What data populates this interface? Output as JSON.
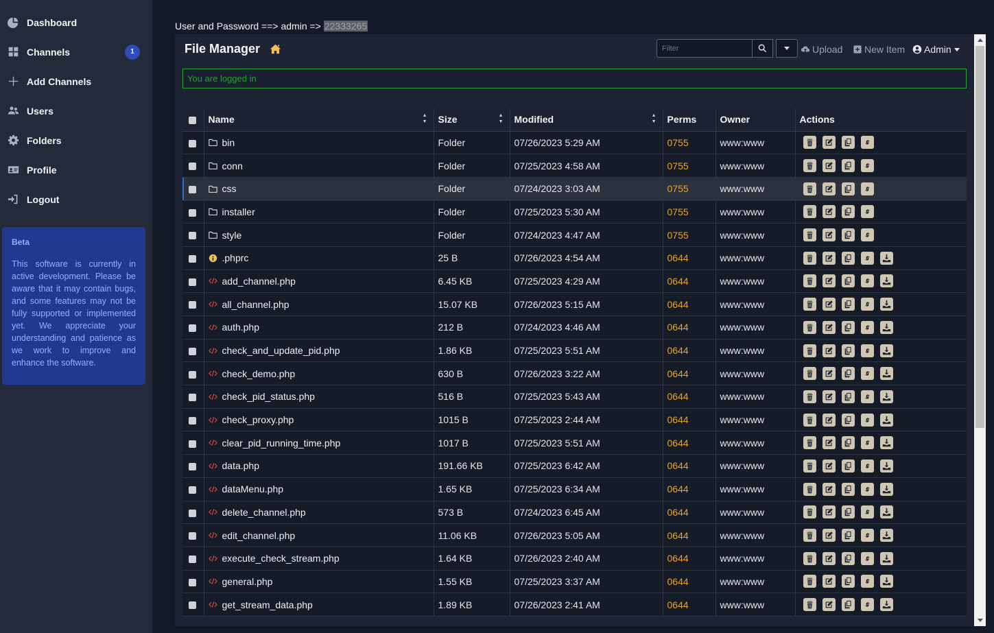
{
  "sidebar": {
    "items": [
      {
        "label": "Dashboard",
        "icon": "pie-chart-icon"
      },
      {
        "label": "Channels",
        "icon": "grid-icon",
        "badge": "1"
      },
      {
        "label": "Add Channels",
        "icon": "plus-icon"
      },
      {
        "label": "Users",
        "icon": "users-icon"
      },
      {
        "label": "Folders",
        "icon": "gear-icon"
      },
      {
        "label": "Profile",
        "icon": "id-card-icon"
      },
      {
        "label": "Logout",
        "icon": "logout-icon"
      }
    ],
    "beta": {
      "title": "Beta",
      "text": "This software is currently in active development. Please be aware that it may contain bugs, and some features may not be fully supported or implemented yet. We appreciate your understanding and patience as we work to improve and enhance the software."
    }
  },
  "credentials": {
    "text": "User and Password ==> admin =>",
    "password": "22333265"
  },
  "header": {
    "title": "File Manager",
    "filter_placeholder": "Filter",
    "upload": "Upload",
    "new_item": "New Item",
    "admin": "Admin"
  },
  "message": "You are logged in",
  "table": {
    "columns": [
      "Name",
      "Size",
      "Modified",
      "Perms",
      "Owner",
      "Actions"
    ],
    "rows": [
      {
        "name": "bin",
        "type": "folder",
        "size": "Folder",
        "modified": "07/26/2023 5:29 AM",
        "perms": "0755",
        "owner": "www:www"
      },
      {
        "name": "conn",
        "type": "folder",
        "size": "Folder",
        "modified": "07/25/2023 4:58 AM",
        "perms": "0755",
        "owner": "www:www"
      },
      {
        "name": "css",
        "type": "folder",
        "size": "Folder",
        "modified": "07/24/2023 3:03 AM",
        "perms": "0755",
        "owner": "www:www"
      },
      {
        "name": "installer",
        "type": "folder",
        "size": "Folder",
        "modified": "07/25/2023 5:30 AM",
        "perms": "0755",
        "owner": "www:www"
      },
      {
        "name": "style",
        "type": "folder",
        "size": "Folder",
        "modified": "07/24/2023 4:47 AM",
        "perms": "0755",
        "owner": "www:www"
      },
      {
        "name": ".phprc",
        "type": "info",
        "size": "25 B",
        "modified": "07/26/2023 4:54 AM",
        "perms": "0644",
        "owner": "www:www"
      },
      {
        "name": "add_channel.php",
        "type": "code",
        "size": "6.45 KB",
        "modified": "07/25/2023 4:29 AM",
        "perms": "0644",
        "owner": "www:www"
      },
      {
        "name": "all_channel.php",
        "type": "code",
        "size": "15.07 KB",
        "modified": "07/26/2023 5:15 AM",
        "perms": "0644",
        "owner": "www:www"
      },
      {
        "name": "auth.php",
        "type": "code",
        "size": "212 B",
        "modified": "07/24/2023 4:46 AM",
        "perms": "0644",
        "owner": "www:www"
      },
      {
        "name": "check_and_update_pid.php",
        "type": "code",
        "size": "1.86 KB",
        "modified": "07/25/2023 5:51 AM",
        "perms": "0644",
        "owner": "www:www"
      },
      {
        "name": "check_demo.php",
        "type": "code",
        "size": "630 B",
        "modified": "07/26/2023 3:22 AM",
        "perms": "0644",
        "owner": "www:www"
      },
      {
        "name": "check_pid_status.php",
        "type": "code",
        "size": "516 B",
        "modified": "07/25/2023 5:43 AM",
        "perms": "0644",
        "owner": "www:www"
      },
      {
        "name": "check_proxy.php",
        "type": "code",
        "size": "1015 B",
        "modified": "07/25/2023 2:44 AM",
        "perms": "0644",
        "owner": "www:www"
      },
      {
        "name": "clear_pid_running_time.php",
        "type": "code",
        "size": "1017 B",
        "modified": "07/25/2023 5:51 AM",
        "perms": "0644",
        "owner": "www:www"
      },
      {
        "name": "data.php",
        "type": "code",
        "size": "191.66 KB",
        "modified": "07/25/2023 6:42 AM",
        "perms": "0644",
        "owner": "www:www"
      },
      {
        "name": "dataMenu.php",
        "type": "code",
        "size": "1.65 KB",
        "modified": "07/25/2023 6:34 AM",
        "perms": "0644",
        "owner": "www:www"
      },
      {
        "name": "delete_channel.php",
        "type": "code",
        "size": "573 B",
        "modified": "07/24/2023 6:45 AM",
        "perms": "0644",
        "owner": "www:www"
      },
      {
        "name": "edit_channel.php",
        "type": "code",
        "size": "11.06 KB",
        "modified": "07/26/2023 5:05 AM",
        "perms": "0644",
        "owner": "www:www"
      },
      {
        "name": "execute_check_stream.php",
        "type": "code",
        "size": "1.64 KB",
        "modified": "07/26/2023 2:40 AM",
        "perms": "0644",
        "owner": "www:www"
      },
      {
        "name": "general.php",
        "type": "code",
        "size": "1.55 KB",
        "modified": "07/25/2023 3:37 AM",
        "perms": "0644",
        "owner": "www:www"
      },
      {
        "name": "get_stream_data.php",
        "type": "code",
        "size": "1.89 KB",
        "modified": "07/26/2023 2:41 AM",
        "perms": "0644",
        "owner": "www:www"
      }
    ],
    "highlighted_row": 2
  },
  "colors": {
    "sidebar_bg": "#232a3a",
    "page_bg": "#141a27",
    "accent_blue": "#2f4bb8",
    "perms_orange": "#f2a31d",
    "code_icon_red": "#e0453a",
    "success_green": "#25a634",
    "home_icon_yellow": "#f4c150"
  }
}
